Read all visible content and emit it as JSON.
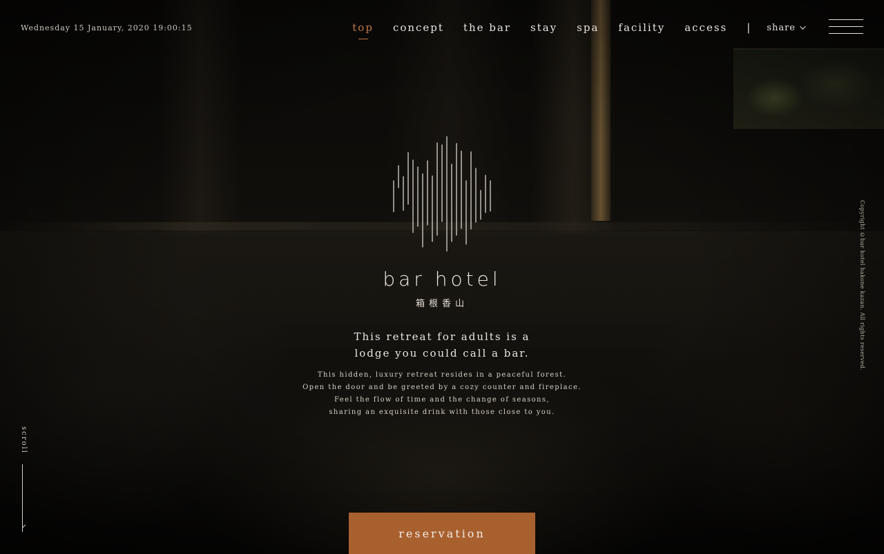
{
  "header": {
    "datetime": "Wednesday 15 January, 2020 19:00:15",
    "nav": [
      {
        "label": "top",
        "active": true
      },
      {
        "label": "concept"
      },
      {
        "label": "the bar"
      },
      {
        "label": "stay"
      },
      {
        "label": "spa"
      },
      {
        "label": "facility"
      },
      {
        "label": "access"
      }
    ],
    "separator": "|",
    "share_label": "share",
    "menu_icon": "hamburger-menu-icon"
  },
  "hero": {
    "brand_name": "bar hotel",
    "brand_japanese": "箱根香山",
    "tagline": [
      "This retreat for adults is a",
      "lodge you could call a bar."
    ],
    "description": [
      "This hidden, luxury retreat resides in a peaceful forest.",
      "Open the door and be greeted by a cozy counter and fireplace.",
      "Feel the flow of time and the change of seasons,",
      "sharing an exquisite drink with those close to you."
    ],
    "reservation_label": "reservation"
  },
  "side": {
    "scroll_label": "scroll",
    "copyright": "Copyright ©bar hotel hakone kazan. All rights reserved."
  },
  "colors": {
    "accent": "#c87845",
    "button": "#a8602f",
    "text": "#e9e4dc"
  }
}
